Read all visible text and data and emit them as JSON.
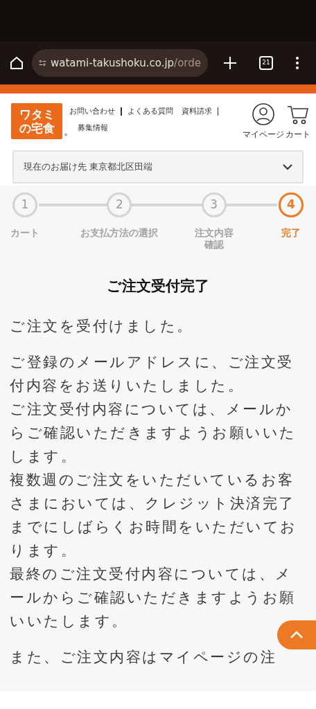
{
  "browser": {
    "url_host": "watami-takushoku.co.jp",
    "url_path": "/orde",
    "tab_count": "21"
  },
  "header": {
    "logo_lines": [
      "ワタミ",
      "の宅食"
    ],
    "logo_mark": "®",
    "links": [
      "お問い合わせ",
      "よくある質問",
      "資料請求",
      "募集情報"
    ],
    "mypage": "マイページ",
    "cart": "カート"
  },
  "delivery": {
    "label": "現在のお届け先 東京都北区田端"
  },
  "steps": [
    {
      "number": "1",
      "label": "カート",
      "selected": false
    },
    {
      "number": "2",
      "label": "お支払方法の選択",
      "selected": false
    },
    {
      "number": "3",
      "label": "注文内容確認",
      "selected": false
    },
    {
      "number": "4",
      "label": "完了",
      "selected": true
    }
  ],
  "title": "ご注文受付完了",
  "paragraphs": [
    [
      "ご注文を受付けました。"
    ],
    [
      "ご登録のメールアドレスに、ご注文受付内容をお送りいたしました。",
      "ご注文受付内容については、メールからご確認いただきますようお願いいたします。",
      "複数週のご注文をいただいているお客さまにおいては、クレジット決済完了までにしばらくお時間をいただいております。",
      "最終のご注文受付内容については、メールからご確認いただきますようお願いいたします。"
    ],
    [
      "また、ご注文内容はマイページの注"
    ]
  ]
}
